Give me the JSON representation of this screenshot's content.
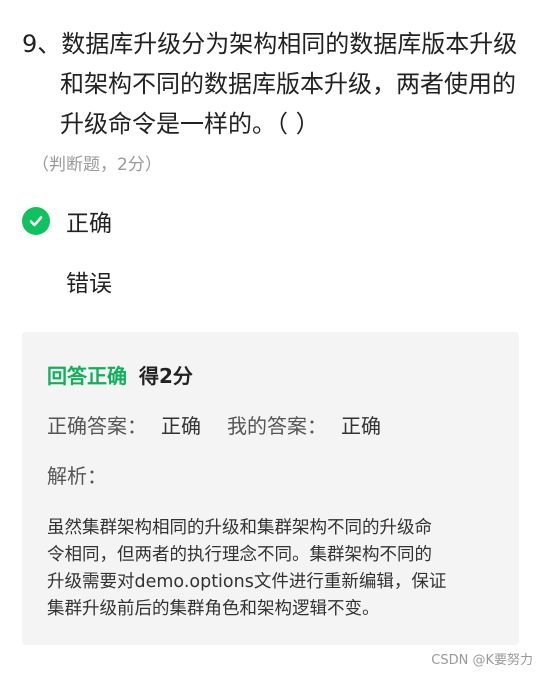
{
  "question": {
    "lines": [
      "9、数据库升级分为架构相同的数据库版本升级",
      "和架构不同的数据库版本升级，两者使用的",
      "升级命令是一样的。（ ）"
    ],
    "type_label": "（判断题，2分）"
  },
  "options": [
    {
      "label": "正确",
      "selected": true
    },
    {
      "label": "错误",
      "selected": false
    }
  ],
  "result": {
    "status": "回答正确",
    "score": "得2分",
    "correct_answer_label": "正确答案：",
    "correct_answer": "正确",
    "my_answer_label": "我的答案：",
    "my_answer": "正确",
    "analysis_label": "解析：",
    "analysis_lines": [
      "虽然集群架构相同的升级和集群架构不同的升级命",
      "令相同，但两者的执行理念不同。集群架构不同的",
      "升级需要对demo.options文件进行重新编辑，保证",
      "集群升级前后的集群角色和架构逻辑不变。"
    ]
  },
  "watermark": "CSDN @K要努力",
  "colors": {
    "correct_green": "#10c15f",
    "status_green": "#10b05a",
    "box_background": "#f4f4f4"
  }
}
